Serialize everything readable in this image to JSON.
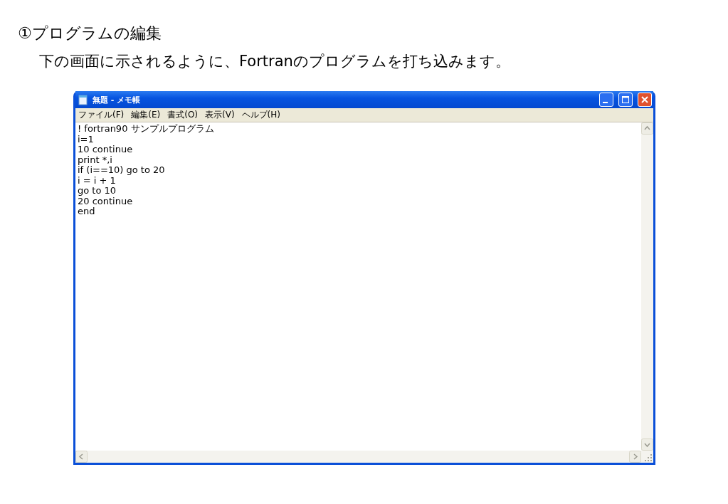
{
  "heading": "①プログラムの編集",
  "intro": "下の画面に示されるように、Fortranのプログラムを打ち込みます。",
  "window": {
    "title": "無題 - メモ帳"
  },
  "menu": [
    "ファイル(F)",
    "編集(E)",
    "書式(O)",
    "表示(V)",
    "ヘルプ(H)"
  ],
  "editor": {
    "lines": [
      "! fortran90 サンプルプログラム",
      "i=1",
      "10 continue",
      "print *,i",
      "if (i==10) go to 20",
      "i = i + 1",
      "go to 10",
      "20 continue",
      "end"
    ]
  }
}
